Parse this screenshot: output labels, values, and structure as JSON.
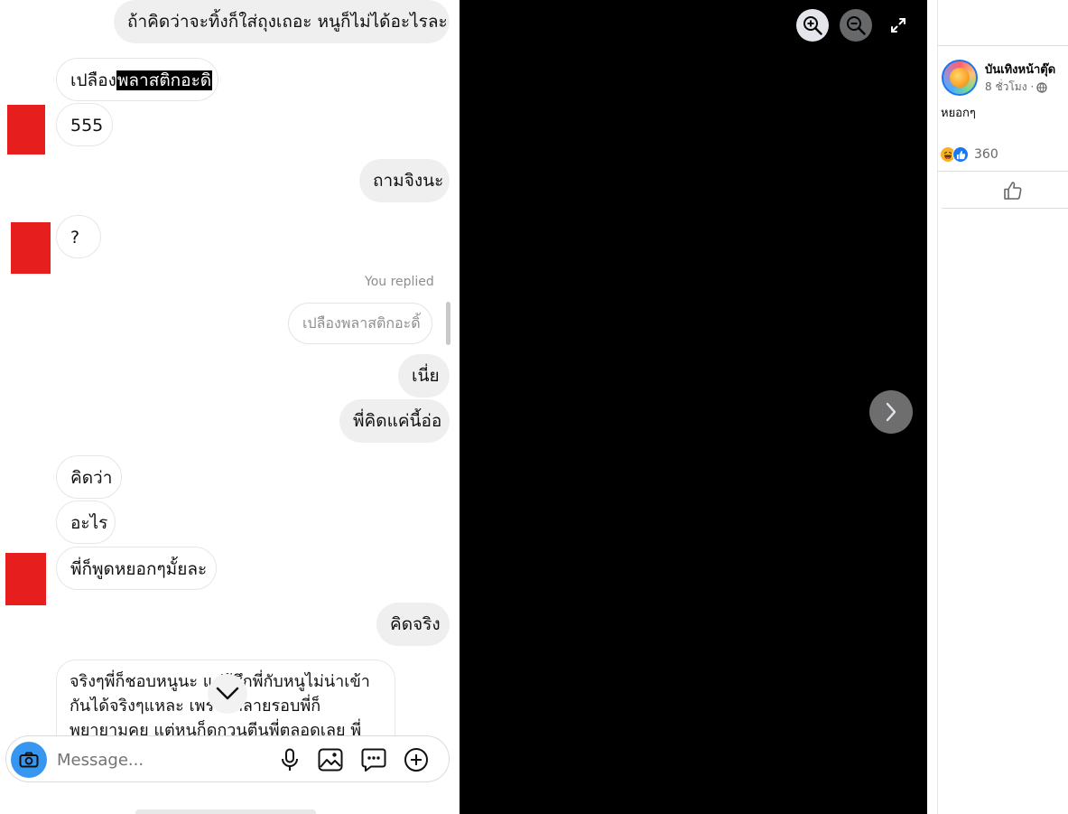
{
  "chat": {
    "messages": [
      {
        "side": "me",
        "text": "ถ้าคิดว่าจะทิ้งก็ใส่ถุงเถอะ หนูก็ไม่ได้อะไรละ"
      },
      {
        "side": "them",
        "text_plain": "เปลือง",
        "text_highlight": "พลาสติกอะดิ"
      },
      {
        "side": "them",
        "text": "555"
      },
      {
        "side": "me",
        "text": "ถามจิงนะ"
      },
      {
        "side": "them",
        "text": "?"
      },
      {
        "side": "me",
        "text": "เนี่ย"
      },
      {
        "side": "me",
        "text": "พี่คิดแค่นี้อ่อ"
      },
      {
        "side": "them",
        "text": "คิดว่า"
      },
      {
        "side": "them",
        "text": "อะไร"
      },
      {
        "side": "them",
        "text": "พี่ก็พูดหยอกๆมั้ยละ"
      },
      {
        "side": "me",
        "text": "คิดจริง"
      }
    ],
    "replied_label": "You replied",
    "replied_quote": "เปลืองพลาสติกอะดิ้",
    "long_message": "จริงๆพี่ก็ชอบหนูนะ แต่รู้สึกพี่กับหนูไม่น่าเข้า\nกันได้จริงๆแหละ เพราะหลายรอบพี่ก็\nพยายามคุย แต่หนูก็ดูกวนตีนพี่ตลอดเลย พี่",
    "composer_placeholder": "Message..."
  },
  "viewer": {
    "zoom_in_icon": "zoom-in-icon",
    "zoom_out_icon": "zoom-out-icon",
    "fullscreen_icon": "fullscreen-icon",
    "next_icon": "chevron-right-icon"
  },
  "post": {
    "page_name": "บันเทิงหน้าตุ๊ด",
    "time": "8 ชั่วโมง ·",
    "caption": "หยอกๆ",
    "reaction_count": "360",
    "reactions": [
      "haha",
      "like"
    ]
  },
  "colors": {
    "viewer_bg": "#000000",
    "redaction": "#e61e1e",
    "composer_camera": "#3797f0",
    "fb_blue": "#1877f2"
  }
}
